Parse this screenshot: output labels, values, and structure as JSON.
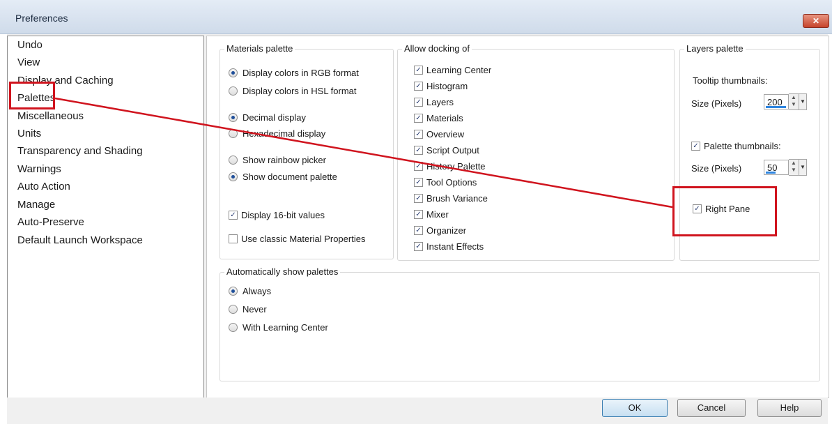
{
  "window": {
    "title": "Preferences",
    "close_glyph": "✕"
  },
  "nav": {
    "items": [
      "Undo",
      "View",
      "Display and Caching",
      "Palettes",
      "Miscellaneous",
      "Units",
      "Transparency and Shading",
      "Warnings",
      "Auto Action",
      "Manage",
      "Auto-Preserve",
      "Default Launch Workspace"
    ],
    "selected": "Palettes"
  },
  "materials": {
    "title": "Materials palette",
    "color_format": [
      "Display colors in RGB format",
      "Display colors in HSL format"
    ],
    "color_format_selected": "Display colors in RGB format",
    "display_mode": [
      "Decimal display",
      "Hexadecimal display"
    ],
    "display_mode_selected": "Decimal display",
    "picker": [
      "Show rainbow picker",
      "Show document palette"
    ],
    "picker_selected": "Show document palette",
    "display_16bit": {
      "label": "Display 16-bit values",
      "checked": true
    },
    "classic_props": {
      "label": "Use classic Material Properties",
      "checked": false
    }
  },
  "docking": {
    "title": "Allow docking of",
    "items": [
      {
        "label": "Learning Center",
        "checked": true
      },
      {
        "label": "Histogram",
        "checked": true
      },
      {
        "label": "Layers",
        "checked": true
      },
      {
        "label": "Materials",
        "checked": true
      },
      {
        "label": "Overview",
        "checked": true
      },
      {
        "label": "Script Output",
        "checked": true
      },
      {
        "label": "History Palette",
        "checked": true
      },
      {
        "label": "Tool Options",
        "checked": true
      },
      {
        "label": "Brush Variance",
        "checked": true
      },
      {
        "label": "Mixer",
        "checked": true
      },
      {
        "label": "Organizer",
        "checked": true
      },
      {
        "label": "Instant Effects",
        "checked": true
      }
    ]
  },
  "layers": {
    "title": "Layers palette",
    "tooltip_label": "Tooltip thumbnails:",
    "size_label": "Size (Pixels)",
    "tooltip_size": "200",
    "tooltip_size_level": 0.95,
    "palette_thumbs": {
      "label": "Palette thumbnails:",
      "checked": true
    },
    "palette_size": "50",
    "palette_size_level": 0.45,
    "right_pane": {
      "label": "Right Pane",
      "checked": true
    }
  },
  "auto_show": {
    "title": "Automatically show palettes",
    "options": [
      "Always",
      "Never",
      "With Learning Center"
    ],
    "selected": "Always"
  },
  "buttons": {
    "ok": "OK",
    "cancel": "Cancel",
    "help": "Help"
  },
  "check_glyph": "✓",
  "colors": {
    "highlight": "#d0141e",
    "accent": "#2f86e0"
  }
}
